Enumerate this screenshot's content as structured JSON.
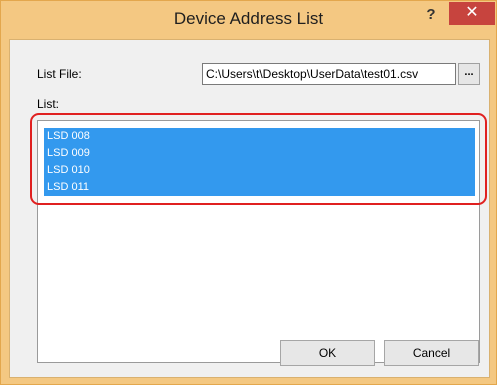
{
  "window": {
    "title": "Device Address List",
    "help_label": "?",
    "close_label": "✕"
  },
  "list_file": {
    "label": "List File:",
    "value": "C:\\Users\\t\\Desktop\\UserData\\test01.csv",
    "browse_label": "..."
  },
  "list": {
    "label": "List:",
    "items": [
      "LSD 008",
      "LSD 009",
      "LSD 010",
      "LSD 011"
    ],
    "selected": [
      true,
      true,
      true,
      true
    ]
  },
  "buttons": {
    "ok_label": "OK",
    "cancel_label": "Cancel"
  },
  "colors": {
    "accent_titlebar": "#f4c882",
    "selection": "#3399ee",
    "close_button": "#c7443e",
    "highlight": "#e02020"
  }
}
